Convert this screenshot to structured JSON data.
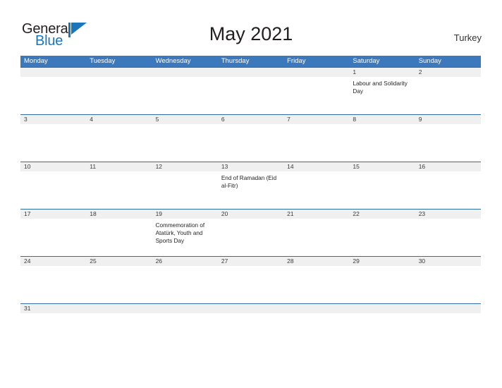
{
  "brand": {
    "name_part1": "General",
    "name_part2": "Blue",
    "flag_icon": "blue-triangle-flag-icon",
    "accent_color": "#1b75bb"
  },
  "header": {
    "title": "May 2021",
    "country": "Turkey"
  },
  "theme": {
    "header_blue": "#3b78bc",
    "row_border_blue": "#2e6da8",
    "band_gray": "#f0f0f0",
    "text_dark": "#231f20"
  },
  "calendar": {
    "month": "May",
    "year": "2021",
    "weekdays": [
      "Monday",
      "Tuesday",
      "Wednesday",
      "Thursday",
      "Friday",
      "Saturday",
      "Sunday"
    ],
    "weeks": [
      {
        "days": [
          {
            "num": "",
            "event": ""
          },
          {
            "num": "",
            "event": ""
          },
          {
            "num": "",
            "event": ""
          },
          {
            "num": "",
            "event": ""
          },
          {
            "num": "",
            "event": ""
          },
          {
            "num": "1",
            "event": "Labour and Solidarity Day"
          },
          {
            "num": "2",
            "event": ""
          }
        ]
      },
      {
        "days": [
          {
            "num": "3",
            "event": ""
          },
          {
            "num": "4",
            "event": ""
          },
          {
            "num": "5",
            "event": ""
          },
          {
            "num": "6",
            "event": ""
          },
          {
            "num": "7",
            "event": ""
          },
          {
            "num": "8",
            "event": ""
          },
          {
            "num": "9",
            "event": ""
          }
        ]
      },
      {
        "days": [
          {
            "num": "10",
            "event": ""
          },
          {
            "num": "11",
            "event": ""
          },
          {
            "num": "12",
            "event": ""
          },
          {
            "num": "13",
            "event": "End of Ramadan (Eid al-Fitr)"
          },
          {
            "num": "14",
            "event": ""
          },
          {
            "num": "15",
            "event": ""
          },
          {
            "num": "16",
            "event": ""
          }
        ]
      },
      {
        "days": [
          {
            "num": "17",
            "event": ""
          },
          {
            "num": "18",
            "event": ""
          },
          {
            "num": "19",
            "event": "Commemoration of Atatürk, Youth and Sports Day"
          },
          {
            "num": "20",
            "event": ""
          },
          {
            "num": "21",
            "event": ""
          },
          {
            "num": "22",
            "event": ""
          },
          {
            "num": "23",
            "event": ""
          }
        ]
      },
      {
        "days": [
          {
            "num": "24",
            "event": ""
          },
          {
            "num": "25",
            "event": ""
          },
          {
            "num": "26",
            "event": ""
          },
          {
            "num": "27",
            "event": ""
          },
          {
            "num": "28",
            "event": ""
          },
          {
            "num": "29",
            "event": ""
          },
          {
            "num": "30",
            "event": ""
          }
        ]
      },
      {
        "days": [
          {
            "num": "31",
            "event": ""
          },
          {
            "num": "",
            "event": ""
          },
          {
            "num": "",
            "event": ""
          },
          {
            "num": "",
            "event": ""
          },
          {
            "num": "",
            "event": ""
          },
          {
            "num": "",
            "event": ""
          },
          {
            "num": "",
            "event": ""
          }
        ]
      }
    ]
  }
}
